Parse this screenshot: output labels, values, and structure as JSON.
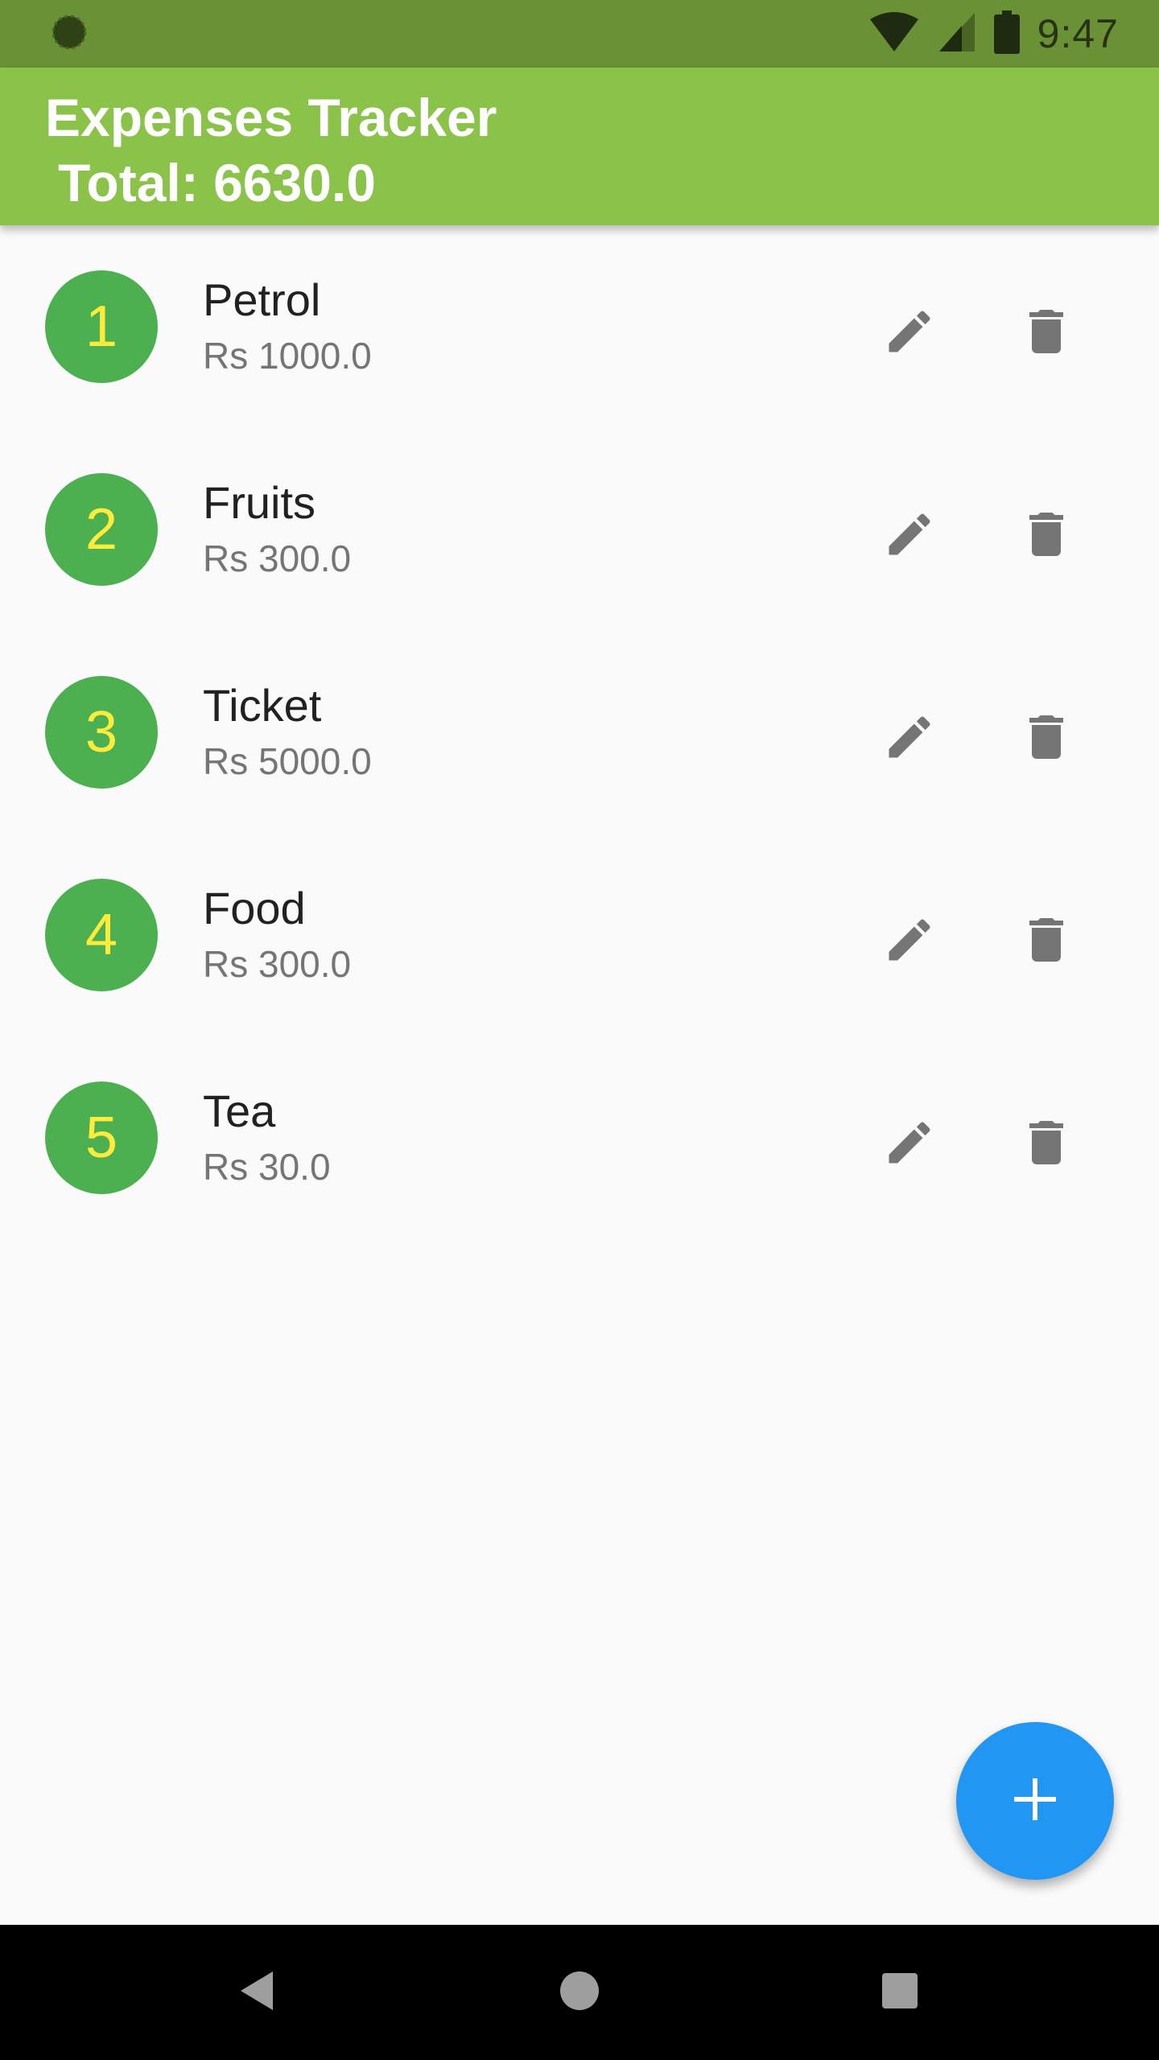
{
  "status_bar": {
    "time": "9:47",
    "icons": [
      "app-notification-icon",
      "wifi-icon",
      "signal-icon",
      "battery-icon"
    ]
  },
  "app_bar": {
    "title": "Expenses Tracker",
    "total": "Total: 6630.0",
    "color": "#8bc34a"
  },
  "expenses": [
    {
      "index": "1",
      "name": "Petrol",
      "amount": "Rs 1000.0"
    },
    {
      "index": "2",
      "name": "Fruits",
      "amount": "Rs 300.0"
    },
    {
      "index": "3",
      "name": "Ticket",
      "amount": "Rs 5000.0"
    },
    {
      "index": "4",
      "name": "Food",
      "amount": "Rs 300.0"
    },
    {
      "index": "5",
      "name": "Tea",
      "amount": "Rs 30.0"
    }
  ],
  "item_icons": {
    "edit": "pencil-icon",
    "delete": "trash-icon"
  },
  "fab": {
    "icon": "plus-icon",
    "color": "#2196f3"
  },
  "nav_bar": {
    "icons": [
      "back-icon",
      "home-icon",
      "recents-icon"
    ]
  },
  "colors": {
    "avatar_bg": "#4caf50",
    "avatar_text": "#ffeb3b",
    "status_bar": "#6a9136"
  }
}
